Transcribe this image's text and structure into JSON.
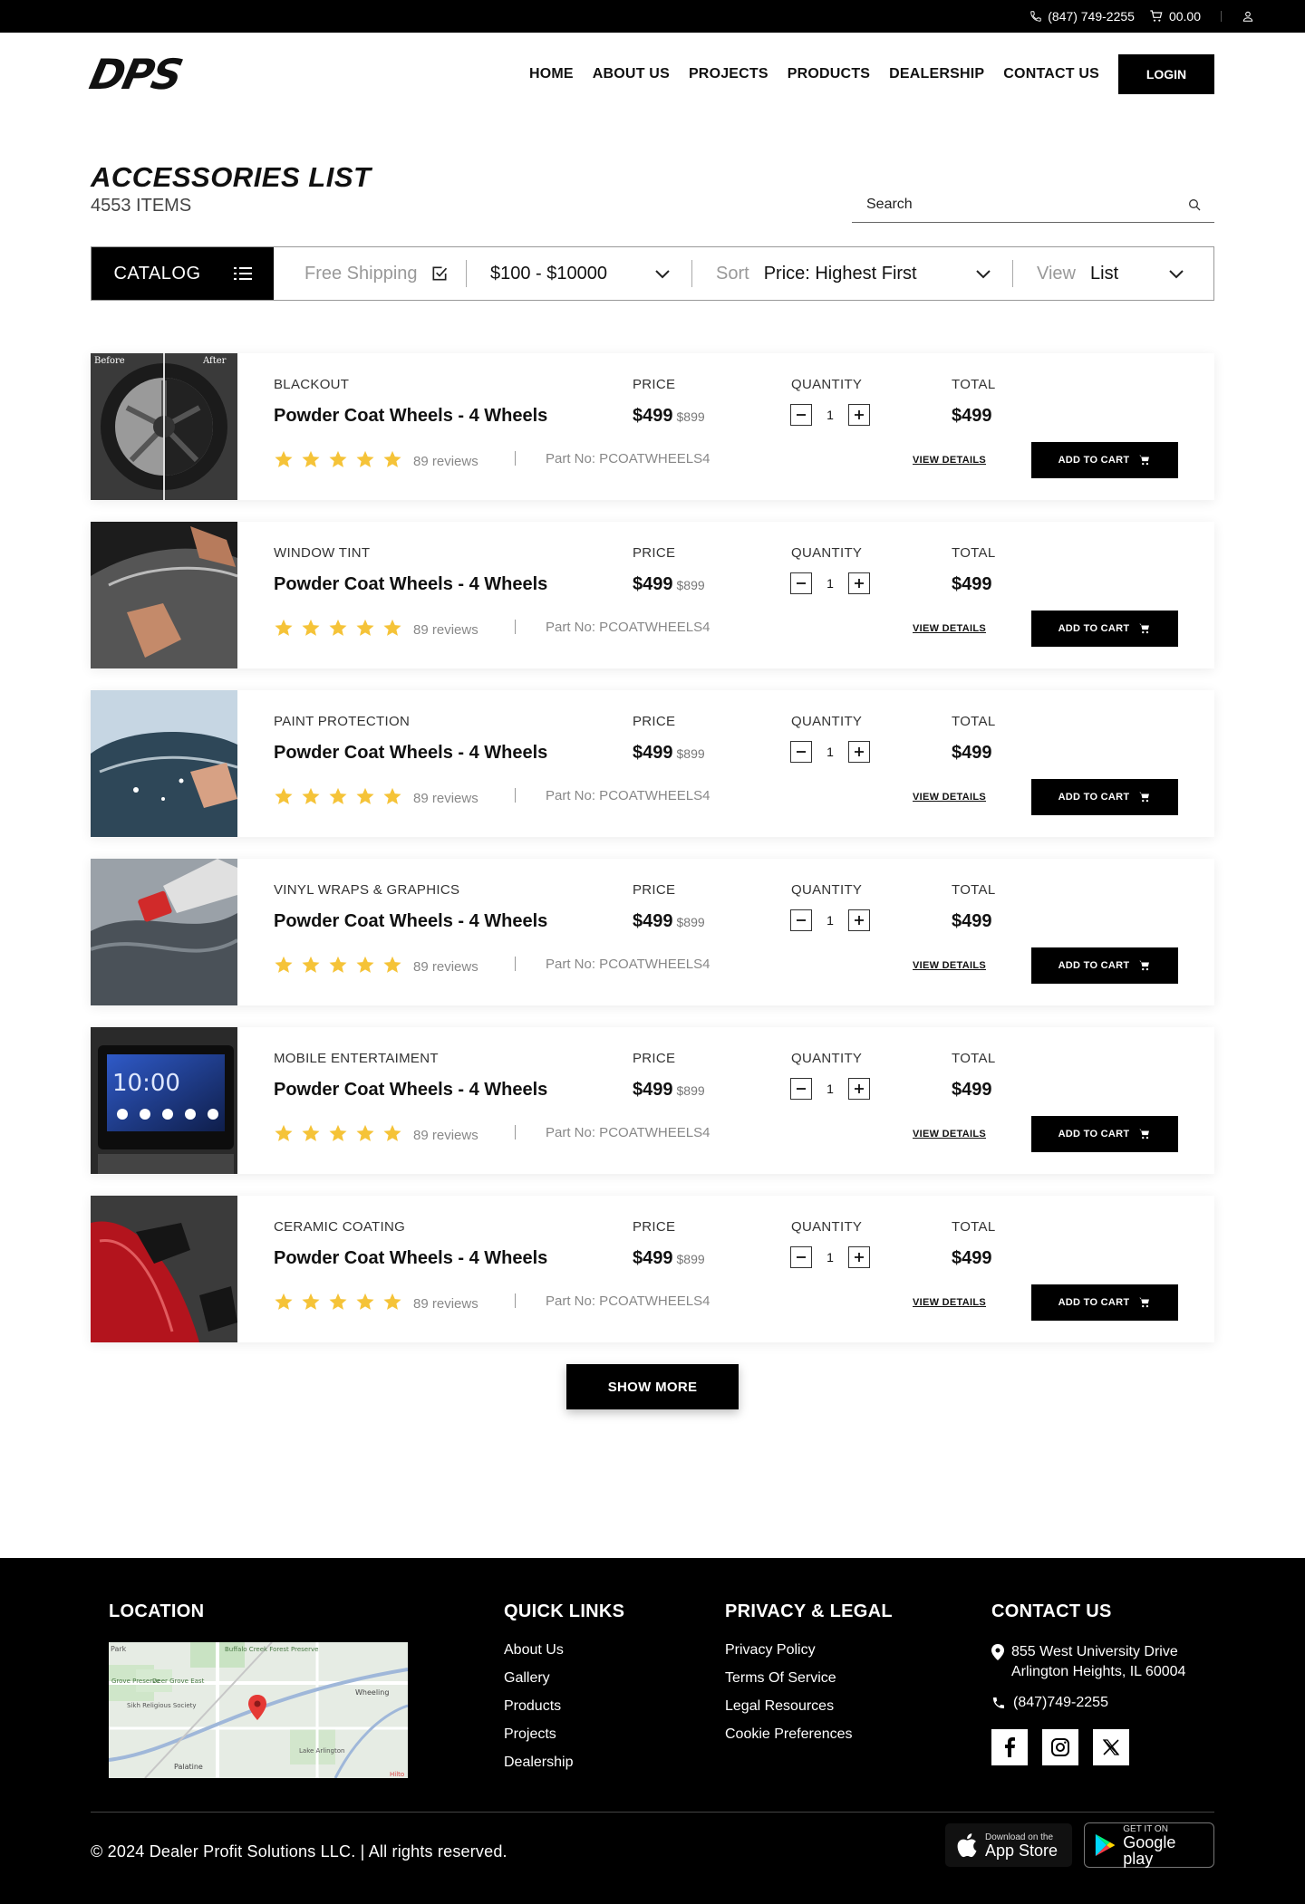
{
  "topbar": {
    "phone": "(847) 749-2255",
    "cart_total": "00.00"
  },
  "header": {
    "logo": "DPS",
    "nav": [
      "HOME",
      "ABOUT US",
      "PROJECTS",
      "PRODUCTS",
      "DEALERSHIP",
      "CONTACT US"
    ],
    "login": "LOGIN"
  },
  "page": {
    "title": "ACCESSORIES LIST",
    "count": "4553 ITEMS",
    "search_placeholder": "Search"
  },
  "filters": {
    "catalog": "CATALOG",
    "free_shipping": "Free Shipping",
    "price_range": "$100 - $10000",
    "sort_label": "Sort",
    "sort_value": "Price: Highest First",
    "view_label": "View",
    "view_value": "List"
  },
  "labels": {
    "price": "PRICE",
    "quantity": "QUANTITY",
    "total": "TOTAL",
    "view_details": "VIEW DETAILS",
    "add_to_cart": "ADD TO CART",
    "show_more": "SHOW MORE"
  },
  "products": [
    {
      "category": "BLACKOUT",
      "name": "Powder Coat Wheels - 4 Wheels",
      "price": "$499",
      "old_price": "$899",
      "qty": "1",
      "total": "$499",
      "reviews": "89 reviews",
      "part_no": "Part No: PCOATWHEELS4",
      "rating": 5,
      "image": "wheel-before-after",
      "img_before": "Before",
      "img_after": "After"
    },
    {
      "category": "WINDOW TINT",
      "name": "Powder Coat Wheels - 4 Wheels",
      "price": "$499",
      "old_price": "$899",
      "qty": "1",
      "total": "$499",
      "reviews": "89 reviews",
      "part_no": "Part No: PCOATWHEELS4",
      "rating": 5,
      "image": "window-tint"
    },
    {
      "category": "PAINT PROTECTION",
      "name": "Powder Coat Wheels - 4 Wheels",
      "price": "$499",
      "old_price": "$899",
      "qty": "1",
      "total": "$499",
      "reviews": "89 reviews",
      "part_no": "Part No: PCOATWHEELS4",
      "rating": 5,
      "image": "paint-protection"
    },
    {
      "category": "VINYL WRAPS & GRAPHICS",
      "name": "Powder Coat Wheels - 4 Wheels",
      "price": "$499",
      "old_price": "$899",
      "qty": "1",
      "total": "$499",
      "reviews": "89 reviews",
      "part_no": "Part No: PCOATWHEELS4",
      "rating": 5,
      "image": "vinyl-wrap"
    },
    {
      "category": "MOBILE ENTERTAIMENT",
      "name": "Powder Coat Wheels - 4 Wheels",
      "price": "$499",
      "old_price": "$899",
      "qty": "1",
      "total": "$499",
      "reviews": "89 reviews",
      "part_no": "Part No: PCOATWHEELS4",
      "rating": 5,
      "image": "car-stereo",
      "img_clock": "10:00"
    },
    {
      "category": "CERAMIC COATING",
      "name": "Powder Coat Wheels - 4 Wheels",
      "price": "$499",
      "old_price": "$899",
      "qty": "1",
      "total": "$499",
      "reviews": "89 reviews",
      "part_no": "Part No: PCOATWHEELS4",
      "rating": 5,
      "image": "ceramic-coating"
    }
  ],
  "footer": {
    "location_heading": "LOCATION",
    "map_labels": [
      "Park",
      "Buffalo Creek Forest Preserve",
      "Grove Preserve",
      "Deer Grove East",
      "Wheeling",
      "Sikh Religious Society",
      "Palatine",
      "Lake Arlington",
      "Hilto"
    ],
    "quick_links_heading": "QUICK LINKS",
    "quick_links": [
      "About Us",
      "Gallery",
      "Products",
      "Projects",
      "Dealership"
    ],
    "privacy_heading": "PRIVACY & LEGAL",
    "privacy_links": [
      "Privacy Policy",
      "Terms Of Service",
      "Legal Resources",
      "Cookie Preferences"
    ],
    "contact_heading": "CONTACT US",
    "address_1": "855 West University Drive",
    "address_2": "Arlington Heights, IL 60004",
    "phone": "(847)749-2255",
    "copyright": "© 2024 Dealer Profit Solutions LLC.  | All rights reserved.",
    "app_store_small": "Download on the",
    "app_store_big": "App Store",
    "google_small": "GET IT ON",
    "google_big": "Google play"
  },
  "colors": {
    "star": "#F5C338",
    "primary": "#000000",
    "map_pin": "#E53935"
  }
}
